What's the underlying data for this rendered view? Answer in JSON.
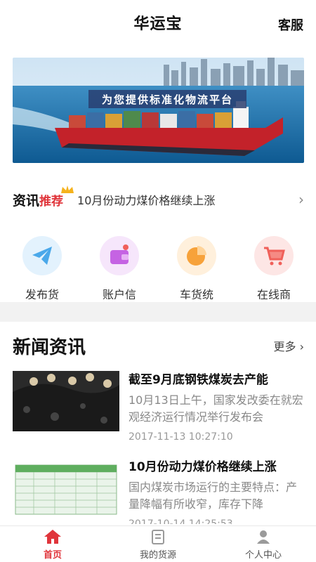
{
  "header": {
    "title": "华运宝",
    "service": "客服"
  },
  "banner": {
    "slogan": "为您提供标准化物流平台"
  },
  "ticker": {
    "label_black": "资讯",
    "label_red": "推荐",
    "headline": "10月份动力煤价格继续上涨"
  },
  "quick_actions": [
    {
      "label": "发布货",
      "icon": "paper-plane-icon",
      "color": "#5ab4ee"
    },
    {
      "label": "账户信",
      "icon": "wallet-icon",
      "color": "#c96ee6"
    },
    {
      "label": "车货统",
      "icon": "pie-chart-icon",
      "color": "#f7a23a"
    },
    {
      "label": "在线商",
      "icon": "shopping-cart-icon",
      "color": "#f0605a"
    }
  ],
  "news": {
    "heading": "新闻资讯",
    "more": "更多",
    "items": [
      {
        "title": "截至9月底钢铁煤炭去产能",
        "summary": "10月13日上午，国家发改委在就宏观经济运行情况举行发布会",
        "time": "2017-11-13 10:27:10"
      },
      {
        "title": "10月份动力煤价格继续上涨",
        "summary": "国内煤炭市场运行的主要特点：产量降幅有所收窄，库存下降",
        "time": "2017-10-14 14:25:53"
      }
    ]
  },
  "tabbar": [
    {
      "label": "首页",
      "icon": "home-icon"
    },
    {
      "label": "我的货源",
      "icon": "document-icon"
    },
    {
      "label": "个人中心",
      "icon": "user-icon"
    }
  ],
  "colors": {
    "accent": "#e0353b"
  }
}
